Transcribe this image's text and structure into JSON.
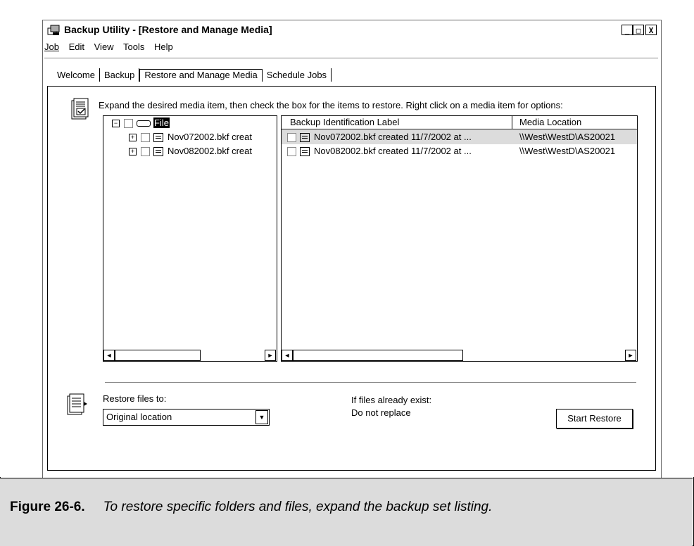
{
  "window": {
    "title": "Backup Utility - [Restore and Manage Media]",
    "controls": [
      "_",
      "□",
      "X"
    ]
  },
  "menu": [
    {
      "label": "Job"
    },
    {
      "label": "Edit"
    },
    {
      "label": "View"
    },
    {
      "label": "Tools"
    },
    {
      "label": "Help"
    }
  ],
  "tabs": [
    {
      "label": "Welcome"
    },
    {
      "label": "Backup"
    },
    {
      "label": "Restore and Manage Media",
      "active": true
    },
    {
      "label": "Schedule Jobs"
    }
  ],
  "instruction": "Expand the desired media item, then check the box for the items to restore. Right click on a media item for options:",
  "tree": {
    "root": "File",
    "children": [
      "Nov072002.bkf creat",
      "Nov082002.bkf creat"
    ]
  },
  "list": {
    "columns": [
      "Backup Identification Label",
      "Media Location"
    ],
    "rows": [
      {
        "label": "Nov072002.bkf created 11/7/2002 at ...",
        "location": "\\\\West\\WestD\\AS20021"
      },
      {
        "label": "Nov082002.bkf created 11/7/2002 at ...",
        "location": "\\\\West\\WestD\\AS20021"
      }
    ]
  },
  "restore": {
    "label": "Restore files to:",
    "value": "Original location",
    "exist_label": "If files already exist:",
    "exist_value": "Do not replace",
    "start_button": "Start Restore"
  },
  "caption": {
    "number": "Figure 26-6.",
    "text": "To restore specific folders and files, expand the backup set listing."
  }
}
